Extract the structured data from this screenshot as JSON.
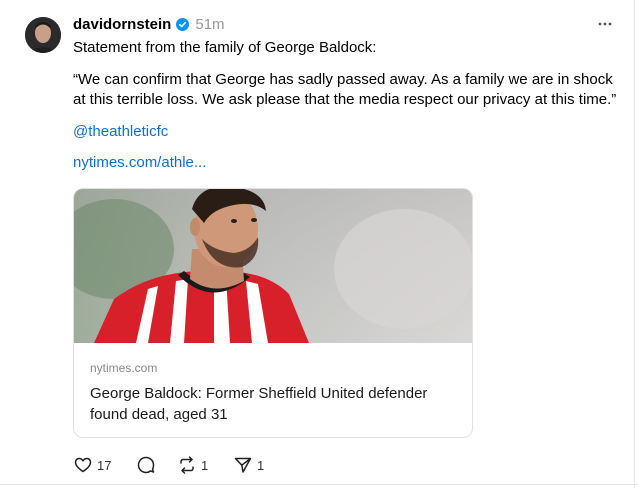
{
  "post": {
    "username": "davidornstein",
    "verified_icon": "verified-badge-icon",
    "time": "51m",
    "text_intro": "Statement from the family of George Baldock:",
    "quote_line1": "“We can confirm that George has sadly passed away. As a family we are in shock",
    "quote_line2": "at this terrible loss. We ask please that the media respect our privacy at this time.”",
    "mention": "@theathleticfc",
    "link": "nytimes.com/athle..."
  },
  "link_card": {
    "domain": "nytimes.com",
    "title": "George Baldock: Former Sheffield United defender found dead, aged 31"
  },
  "actions": {
    "likes": "17",
    "reposts": "1",
    "shares": "1"
  },
  "colors": {
    "link": "#0f6ecd",
    "timestamp": "#999999",
    "verified": "#0095f6"
  }
}
